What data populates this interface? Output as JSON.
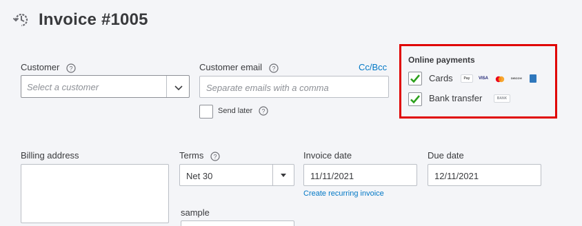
{
  "header": {
    "title": "Invoice #1005",
    "icon": "recent-transactions-icon"
  },
  "customer": {
    "label": "Customer",
    "placeholder": "Select a customer"
  },
  "customer_email": {
    "label": "Customer email",
    "placeholder": "Separate emails with a comma",
    "cc_bcc": "Cc/Bcc",
    "send_later_label": "Send later",
    "send_later_checked": false
  },
  "online_payments": {
    "title": "Online payments",
    "border_color": "#e00000",
    "cards": {
      "label": "Cards",
      "checked": true,
      "badges": [
        "Pay",
        "VISA",
        "mastercard",
        "DISCOVER",
        "amex"
      ]
    },
    "bank_transfer": {
      "label": "Bank transfer",
      "checked": true,
      "badge": "BANK"
    }
  },
  "billing_address": {
    "label": "Billing address",
    "value": ""
  },
  "terms": {
    "label": "Terms",
    "value": "Net 30"
  },
  "invoice_date": {
    "label": "Invoice date",
    "value": "11/11/2021",
    "recurring_link": "Create recurring invoice"
  },
  "due_date": {
    "label": "Due date",
    "value": "12/11/2021"
  },
  "custom_field": {
    "label": "sample",
    "value": ""
  },
  "colors": {
    "link": "#0077c5",
    "check": "#2ca01c",
    "background": "#f4f5f8"
  }
}
